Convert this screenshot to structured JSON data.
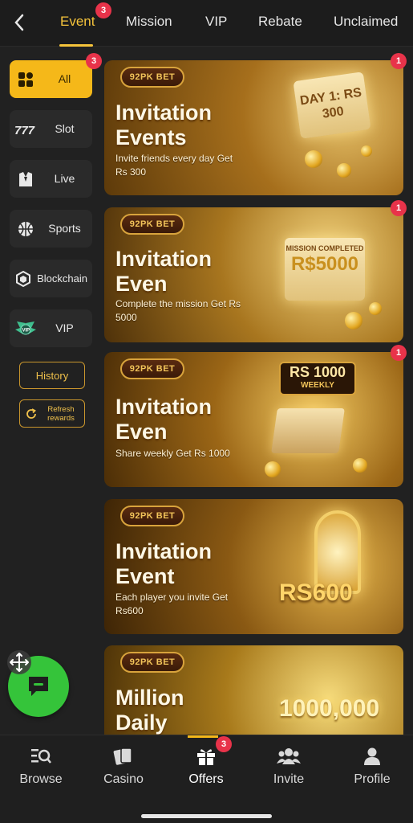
{
  "top_tabs": [
    {
      "label": "Event",
      "active": true,
      "badge": "3"
    },
    {
      "label": "Mission"
    },
    {
      "label": "VIP"
    },
    {
      "label": "Rebate"
    },
    {
      "label": "Unclaimed"
    }
  ],
  "sidebar": {
    "items": [
      {
        "label": "All",
        "icon": "grid-icon",
        "active": true,
        "badge": "3"
      },
      {
        "label": "Slot",
        "icon": "slot-777-icon"
      },
      {
        "label": "Live",
        "icon": "dealer-icon"
      },
      {
        "label": "Sports",
        "icon": "basketball-icon"
      },
      {
        "label": "Blockchain",
        "icon": "blockchain-cube-icon"
      },
      {
        "label": "VIP",
        "icon": "vip-wings-icon"
      }
    ],
    "history_label": "History",
    "refresh_label": "Refresh rewards"
  },
  "banners": [
    {
      "logo": "92PK BET",
      "title": "Invitation Events",
      "desc": "Invite friends every day Get Rs 300",
      "badge": "1",
      "art_text": "DAY 1: RS 300"
    },
    {
      "logo": "92PK BET",
      "title": "Invitation Even",
      "desc": "Complete the mission Get Rs 5000",
      "badge": "1",
      "art_top": "MISSION COMPLETED",
      "art_text": "R$5000"
    },
    {
      "logo": "92PK BET",
      "title": "Invitation Even",
      "desc": "Share weekly Get Rs 1000",
      "badge": "1",
      "art_top": "RS 1000",
      "art_text": "WEEKLY"
    },
    {
      "logo": "92PK BET",
      "title": "Invitation Event",
      "desc": "Each player you invite Get Rs600",
      "art_text": "RS600"
    },
    {
      "logo": "92PK BET",
      "title": "Million Daily",
      "desc": "",
      "art_text": "1000,000"
    }
  ],
  "bottom_nav": [
    {
      "label": "Browse",
      "icon": "browse-search-icon"
    },
    {
      "label": "Casino",
      "icon": "cards-icon"
    },
    {
      "label": "Offers",
      "icon": "gift-icon",
      "active": true,
      "badge": "3"
    },
    {
      "label": "Invite",
      "icon": "group-icon"
    },
    {
      "label": "Profile",
      "icon": "person-icon"
    }
  ],
  "colors": {
    "accent": "#f5b819",
    "badge": "#e8334a",
    "chat_fab": "#35c43a"
  }
}
